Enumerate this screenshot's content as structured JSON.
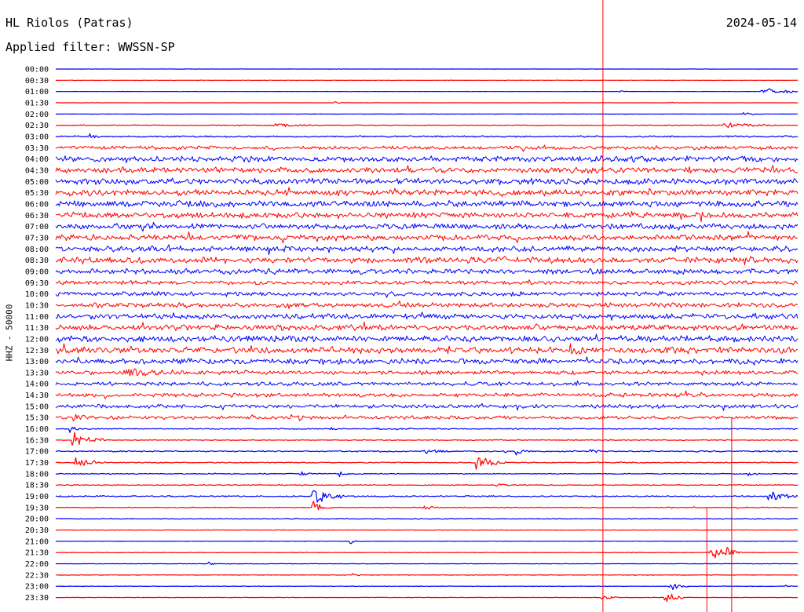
{
  "header": {
    "station": "HL Riolos (Patras)",
    "date": "2024-05-14",
    "filter_label": "Applied filter:",
    "filter_value": "WWSSN-SP"
  },
  "chart_data": {
    "type": "line",
    "subtype": "helicorder",
    "title": "HL Riolos (Patras)",
    "date": "2024-05-14",
    "ylabel": "HHZ - 50000",
    "trace_colors": [
      "#0000ff",
      "#ff0000"
    ],
    "marker_color": "#ff0000",
    "rows": [
      {
        "time": "00:00",
        "activity": 0.05,
        "events": []
      },
      {
        "time": "00:30",
        "activity": 0.07,
        "events": []
      },
      {
        "time": "01:00",
        "activity": 0.05,
        "events": [
          {
            "at_min": 28.5,
            "amplitude": 2.0,
            "duration_min": 1.8
          },
          {
            "at_min": 22.8,
            "amplitude": 0.6,
            "duration_min": 0.4
          }
        ]
      },
      {
        "time": "01:30",
        "activity": 0.05,
        "events": [
          {
            "at_min": 11.3,
            "amplitude": 0.6,
            "duration_min": 0.5
          },
          {
            "at_min": 24.8,
            "amplitude": 0.4,
            "duration_min": 0.4
          }
        ]
      },
      {
        "time": "02:00",
        "activity": 0.08,
        "events": [
          {
            "at_min": 27.8,
            "amplitude": 1.0,
            "duration_min": 0.5
          }
        ]
      },
      {
        "time": "02:30",
        "activity": 0.2,
        "events": [
          {
            "at_min": 8.8,
            "amplitude": 1.0,
            "duration_min": 1.5
          },
          {
            "at_min": 27.0,
            "amplitude": 1.3,
            "duration_min": 2.0
          }
        ]
      },
      {
        "time": "03:00",
        "activity": 0.35,
        "events": [
          {
            "at_min": 1.4,
            "amplitude": 1.0,
            "duration_min": 0.3
          }
        ]
      },
      {
        "time": "03:30",
        "activity": 0.9,
        "events": []
      },
      {
        "time": "04:00",
        "activity": 1.3,
        "events": []
      },
      {
        "time": "04:30",
        "activity": 1.3,
        "events": []
      },
      {
        "time": "05:00",
        "activity": 1.4,
        "events": []
      },
      {
        "time": "05:30",
        "activity": 1.4,
        "events": []
      },
      {
        "time": "06:00",
        "activity": 1.4,
        "events": []
      },
      {
        "time": "06:30",
        "activity": 1.3,
        "events": []
      },
      {
        "time": "07:00",
        "activity": 1.3,
        "events": []
      },
      {
        "time": "07:30",
        "activity": 1.3,
        "events": []
      },
      {
        "time": "08:00",
        "activity": 1.3,
        "events": []
      },
      {
        "time": "08:30",
        "activity": 1.4,
        "events": [
          {
            "at_min": 14.6,
            "amplitude": 1.6,
            "duration_min": 0.8
          }
        ]
      },
      {
        "time": "09:00",
        "activity": 1.3,
        "events": []
      },
      {
        "time": "09:30",
        "activity": 0.9,
        "events": []
      },
      {
        "time": "10:00",
        "activity": 1.0,
        "events": []
      },
      {
        "time": "10:30",
        "activity": 1.1,
        "events": []
      },
      {
        "time": "11:00",
        "activity": 1.2,
        "events": []
      },
      {
        "time": "11:30",
        "activity": 1.3,
        "events": []
      },
      {
        "time": "12:00",
        "activity": 1.4,
        "events": []
      },
      {
        "time": "12:30",
        "activity": 1.5,
        "events": [
          {
            "at_min": 20.8,
            "amplitude": 1.8,
            "duration_min": 0.8
          }
        ]
      },
      {
        "time": "13:00",
        "activity": 1.3,
        "events": []
      },
      {
        "time": "13:30",
        "activity": 0.9,
        "events": [
          {
            "at_min": 2.8,
            "amplitude": 1.7,
            "duration_min": 2.5
          }
        ]
      },
      {
        "time": "14:00",
        "activity": 0.9,
        "events": []
      },
      {
        "time": "14:30",
        "activity": 0.9,
        "events": []
      },
      {
        "time": "15:00",
        "activity": 0.9,
        "events": []
      },
      {
        "time": "15:30",
        "activity": 0.8,
        "events": [
          {
            "at_min": 0.7,
            "amplitude": 1.6,
            "duration_min": 0.8
          },
          {
            "at_min": 9.4,
            "amplitude": 2.5,
            "duration_min": 0.8
          }
        ]
      },
      {
        "time": "16:00",
        "activity": 0.25,
        "events": [
          {
            "at_min": 0.6,
            "amplitude": 2.5,
            "duration_min": 0.4
          },
          {
            "at_min": 11.1,
            "amplitude": 1.2,
            "duration_min": 0.3
          },
          {
            "at_min": 12.9,
            "amplitude": 1.0,
            "duration_min": 0.4
          },
          {
            "at_min": 31.7,
            "amplitude": 1.2,
            "duration_min": 0.3
          }
        ]
      },
      {
        "time": "16:30",
        "activity": 0.2,
        "events": [
          {
            "at_min": 0.7,
            "amplitude": 4.5,
            "duration_min": 1.3
          }
        ]
      },
      {
        "time": "17:00",
        "activity": 0.3,
        "events": [
          {
            "at_min": 14.9,
            "amplitude": 1.2,
            "duration_min": 1.0
          },
          {
            "at_min": 18.6,
            "amplitude": 1.5,
            "duration_min": 0.6
          },
          {
            "at_min": 21.6,
            "amplitude": 1.0,
            "duration_min": 0.5
          },
          {
            "at_min": 31.3,
            "amplitude": 1.0,
            "duration_min": 0.3
          }
        ]
      },
      {
        "time": "17:30",
        "activity": 0.25,
        "events": [
          {
            "at_min": 0.8,
            "amplitude": 3.0,
            "duration_min": 1.2
          },
          {
            "at_min": 17.0,
            "amplitude": 3.5,
            "duration_min": 1.2
          }
        ]
      },
      {
        "time": "18:00",
        "activity": 0.2,
        "events": [
          {
            "at_min": 9.9,
            "amplitude": 1.5,
            "duration_min": 0.5
          },
          {
            "at_min": 11.5,
            "amplitude": 1.2,
            "duration_min": 0.4
          },
          {
            "at_min": 28.0,
            "amplitude": 1.2,
            "duration_min": 0.4
          }
        ]
      },
      {
        "time": "18:30",
        "activity": 0.2,
        "events": [
          {
            "at_min": 17.8,
            "amplitude": 1.0,
            "duration_min": 0.6
          }
        ]
      },
      {
        "time": "19:00",
        "activity": 0.3,
        "events": [
          {
            "at_min": 10.4,
            "amplitude": 4.5,
            "duration_min": 1.3
          },
          {
            "at_min": 28.8,
            "amplitude": 2.5,
            "duration_min": 1.3
          }
        ]
      },
      {
        "time": "19:30",
        "activity": 0.2,
        "events": [
          {
            "at_min": 10.4,
            "amplitude": 3.0,
            "duration_min": 0.8
          },
          {
            "at_min": 14.9,
            "amplitude": 1.3,
            "duration_min": 0.6
          }
        ]
      },
      {
        "time": "20:00",
        "activity": 0.2,
        "events": []
      },
      {
        "time": "20:30",
        "activity": 0.1,
        "events": []
      },
      {
        "time": "21:00",
        "activity": 0.1,
        "events": [
          {
            "at_min": 11.9,
            "amplitude": 1.5,
            "duration_min": 0.3
          }
        ]
      },
      {
        "time": "21:30",
        "activity": 0.1,
        "events": [
          {
            "at_min": 26.4,
            "amplitude": 4.0,
            "duration_min": 1.0
          },
          {
            "at_min": 27.1,
            "amplitude": 3.0,
            "duration_min": 0.6
          }
        ]
      },
      {
        "time": "22:00",
        "activity": 0.1,
        "events": [
          {
            "at_min": 6.2,
            "amplitude": 0.8,
            "duration_min": 0.4
          }
        ]
      },
      {
        "time": "22:30",
        "activity": 0.1,
        "events": [
          {
            "at_min": 12.0,
            "amplitude": 0.6,
            "duration_min": 0.5
          }
        ]
      },
      {
        "time": "23:00",
        "activity": 0.1,
        "events": [
          {
            "at_min": 24.8,
            "amplitude": 2.0,
            "duration_min": 0.8
          },
          {
            "at_min": 29.4,
            "amplitude": 1.0,
            "duration_min": 0.4
          }
        ]
      },
      {
        "time": "23:30",
        "activity": 0.1,
        "events": [
          {
            "at_min": 22.0,
            "amplitude": 1.2,
            "duration_min": 1.0
          },
          {
            "at_min": 24.6,
            "amplitude": 4.0,
            "duration_min": 0.8
          }
        ]
      }
    ],
    "markers": [
      {
        "at_min": 22.1,
        "span": "full"
      },
      {
        "at_min": 26.3,
        "span": "lower",
        "from_time": "19:30"
      },
      {
        "at_min": 27.3,
        "span": "lower",
        "from_time": "15:30"
      }
    ]
  }
}
